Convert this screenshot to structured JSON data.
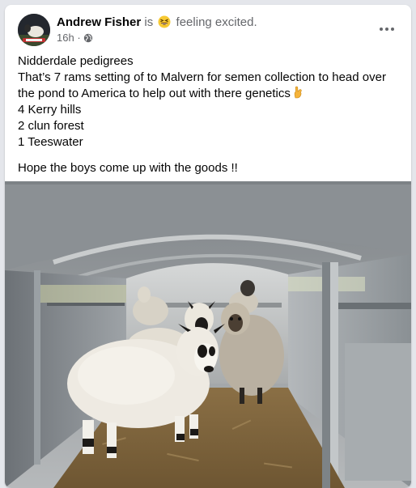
{
  "post": {
    "author": "Andrew Fisher",
    "is_word": "is",
    "feeling": "feeling excited.",
    "timestamp": "16h",
    "separator": "·",
    "privacy_icon": "globe-icon",
    "feeling_icon": "grinning-squint-emoji",
    "more_icon": "more-horizontal-icon",
    "body_lines": [
      "Nidderdale pedigrees",
      "That’s 7 rams setting of to Malvern for semen collection to head over the pond to America to help out with there genetics",
      "4 Kerry hills",
      "2 clun forest",
      "1 Teeswater"
    ],
    "finger_emoji": "crossed-fingers-emoji",
    "closing_line": "Hope the boys come up with the goods !!",
    "photo_icon": "photo-sheep-in-trailer"
  }
}
